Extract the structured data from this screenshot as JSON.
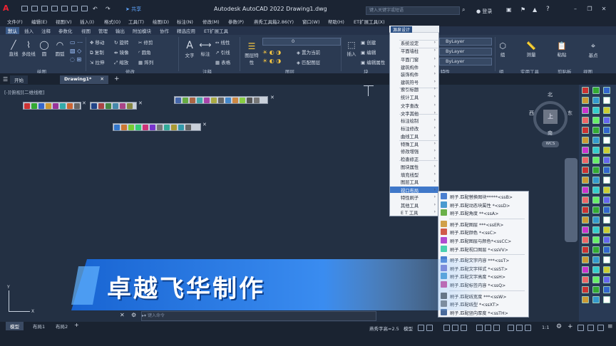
{
  "window": {
    "title": "Autodesk AutoCAD 2022    Drawing1.dwg",
    "search_placeholder": "键入关键字或短语",
    "login": "登录",
    "share": "共享"
  },
  "menubar": [
    "文件(F)",
    "编辑(E)",
    "视图(V)",
    "插入(I)",
    "格式(O)",
    "工具(T)",
    "绘图(D)",
    "标注(N)",
    "修改(M)",
    "参数(P)",
    "燕秀工具箱2.86(Y)",
    "窗口(W)",
    "帮助(H)",
    "ET扩展工具(X)"
  ],
  "ribbon_tabs": [
    "默认",
    "插入",
    "注释",
    "参数化",
    "视图",
    "管理",
    "输出",
    "附加模块",
    "协作",
    "精选应用",
    "ET扩展工具"
  ],
  "ribbon_active": "默认",
  "ribbon": {
    "draw": [
      "直线",
      "多段线",
      "圆",
      "圆弧"
    ],
    "modify": [
      "移动",
      "旋转",
      "修剪",
      "复制",
      "镜像",
      "圆角",
      "拉伸",
      "缩放",
      "阵列"
    ],
    "annotation": [
      "文字",
      "标注",
      "线性",
      "引线",
      "表格"
    ],
    "layers": [
      "图层特性",
      "置为当前",
      "匹配图层"
    ],
    "block": [
      "插入",
      "创建",
      "编辑",
      "编辑属性"
    ],
    "properties": [
      "ByLayer",
      "ByLayer",
      "ByLayer"
    ],
    "groups": [
      "组",
      "测量",
      "粘贴",
      "基点"
    ],
    "panel_labels": [
      "绘图",
      "修改",
      "注释",
      "图层",
      "块",
      "特性",
      "组",
      "实用工具",
      "剪贴板",
      "视图"
    ],
    "layer_value": "0"
  },
  "doc_tabs": [
    "开始",
    "Drawing1*"
  ],
  "viewport_label": "[-][俯视][二维线框]",
  "navcube": {
    "north": "北",
    "south": "南",
    "east": "东",
    "west": "西",
    "top": "上",
    "wcs": "WCS"
  },
  "dropdown": {
    "header": "源泉设计",
    "items": [
      {
        "label": "系统设定",
        "arrow": true
      },
      {
        "label": "平面墙柱",
        "arrow": true
      },
      {
        "label": "平面门窗",
        "arrow": true
      },
      {
        "label": "建筑构件",
        "arrow": true
      },
      {
        "label": "装饰构件",
        "arrow": true
      },
      {
        "label": "建筑符号",
        "arrow": true
      },
      {
        "label": "索引标题",
        "arrow": true
      },
      {
        "label": "统计工具",
        "arrow": true
      },
      {
        "label": "文字查改",
        "arrow": true
      },
      {
        "label": "文字其他",
        "arrow": true
      },
      {
        "label": "标注绘制",
        "arrow": true
      },
      {
        "label": "标注修改",
        "arrow": true
      },
      {
        "label": "曲线工具",
        "arrow": true
      },
      {
        "label": "特殊工具",
        "arrow": true
      },
      {
        "label": "修改增强",
        "arrow": true
      },
      {
        "label": "检查修正",
        "arrow": true
      },
      {
        "label": "图块属性",
        "arrow": true
      },
      {
        "label": "填充线型",
        "arrow": true
      },
      {
        "label": "图层工具",
        "arrow": true
      },
      {
        "label": "视口布局",
        "arrow": true
      },
      {
        "label": "特性刷子",
        "arrow": true
      },
      {
        "label": "其他工具",
        "arrow": true
      },
      {
        "label": "E T 工具",
        "arrow": true
      }
    ],
    "highlighted": "视口布局"
  },
  "submenu": [
    {
      "label": "刷子.匹配替换图块*****<ssB>"
    },
    {
      "label": "刷子.匹配动态块属性 *<ssD>"
    },
    {
      "label": "刷子.匹配角度      **<ssA>"
    },
    {
      "label": "刷子.匹配图层      ***<ssER>"
    },
    {
      "label": "刷子.匹配颜色      *<ssC>"
    },
    {
      "label": "刷子.匹配图层与颜色*<ssCC>"
    },
    {
      "label": "刷子.匹配视口图层 *<ssVV>"
    },
    {
      "label": "刷子.匹配文字内容 ***<ssT>"
    },
    {
      "label": "刷子.匹配文字样式 *<ssST>"
    },
    {
      "label": "刷子.匹配文字高度 *<ssH>"
    },
    {
      "label": "刷子.匹配标签内容 *<ssQ>"
    },
    {
      "label": "刷子.匹配线宽度    ***<ssW>"
    },
    {
      "label": "刷子.匹配线型     *<ssXT>"
    },
    {
      "label": "刷子.匹配竖向厚度 *<ssTH>"
    }
  ],
  "banner": "卓越飞华制作",
  "command": {
    "placeholder": "键入命令"
  },
  "layout_tabs": [
    "模型",
    "布局1",
    "布局2"
  ],
  "status": {
    "annotation": "燕秀字高=2.5",
    "model": "模型",
    "scale": "1:1",
    "plus": "+"
  },
  "colors": {
    "accent": "#3b5b8a",
    "banner": "#1d6fd6",
    "highlight": "#3f78c9"
  }
}
